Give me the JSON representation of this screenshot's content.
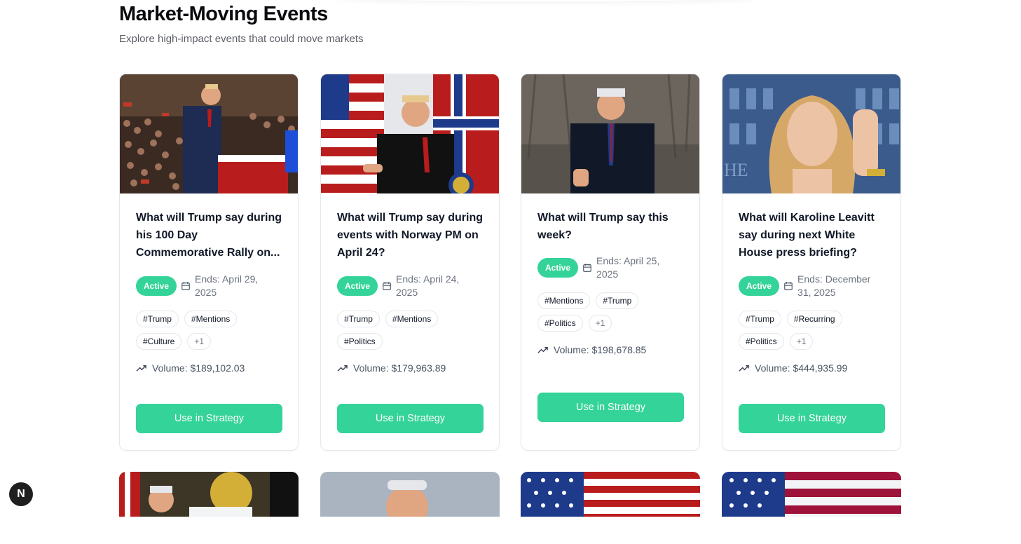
{
  "header": {
    "title": "Market-Moving Events",
    "subtitle": "Explore high-impact events that could move markets"
  },
  "cards": [
    {
      "title": "What will Trump say during his 100 Day Commemorative Rally on...",
      "status": "Active",
      "ends": "Ends: April 29, 2025",
      "tags": [
        "#Trump",
        "#Mentions",
        "#Culture",
        "+1"
      ],
      "volume": "Volume: $189,102.03",
      "button": "Use in Strategy",
      "image": "trump-rally-stage-photo"
    },
    {
      "title": "What will Trump say during events with Norway PM on April 24?",
      "status": "Active",
      "ends": "Ends: April 24, 2025",
      "tags": [
        "#Trump",
        "#Mentions",
        "#Politics"
      ],
      "volume": "Volume: $179,963.89",
      "button": "Use in Strategy",
      "image": "trump-norway-flags-photo"
    },
    {
      "title": "What will Trump say this week?",
      "status": "Active",
      "ends": "Ends: April 25, 2025",
      "tags": [
        "#Mentions",
        "#Trump",
        "#Politics",
        "+1"
      ],
      "volume": "Volume: $198,678.85",
      "button": "Use in Strategy",
      "image": "trump-thumbs-up-photo"
    },
    {
      "title": "What will Karoline Leavitt say during next White House press briefing?",
      "status": "Active",
      "ends": "Ends: December 31, 2025",
      "tags": [
        "#Trump",
        "#Recurring",
        "#Politics",
        "+1"
      ],
      "volume": "Volume: $444,935.99",
      "button": "Use in Strategy",
      "image": "press-secretary-photo"
    }
  ],
  "next_badge": "N",
  "colors": {
    "accent": "#34d399",
    "border": "#e5e7eb",
    "title": "#111827",
    "muted": "#6b7280"
  }
}
